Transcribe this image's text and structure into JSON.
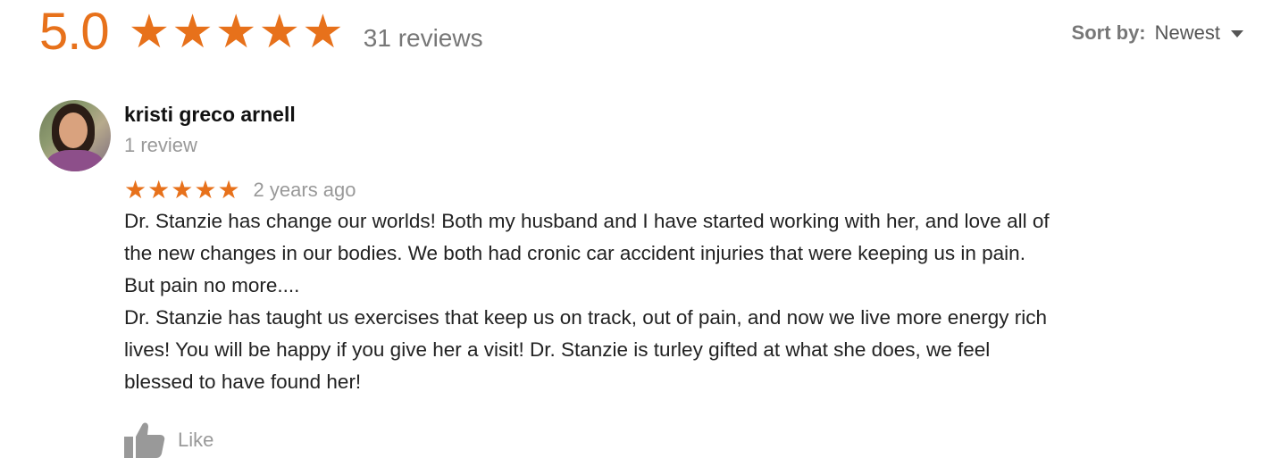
{
  "summary": {
    "score": "5.0",
    "stars": 5,
    "review_count": "31 reviews"
  },
  "sort": {
    "label": "Sort by:",
    "value": "Newest"
  },
  "review": {
    "reviewer_name": "kristi greco arnell",
    "reviewer_meta": "1 review",
    "stars": 5,
    "date": "2 years ago",
    "text_lines": [
      "Dr. Stanzie has change our worlds!  Both my husband and I have started working with her, and love all of",
      "the new changes in our bodies.  We both had cronic car accident injuries that were keeping us in pain.",
      "But pain no more....",
      "Dr. Stanzie has taught us exercises that keep us on track, out of pain, and now we live more energy rich",
      "lives!   You will be happy if you give her a visit!  Dr. Stanzie is turley gifted at what she does, we feel",
      "blessed to have found her!"
    ],
    "like_label": "Like"
  },
  "icons": {
    "star": "star-icon",
    "caret": "caret-down-icon",
    "like": "thumbs-up-icon"
  },
  "colors": {
    "accent": "#e7711b",
    "muted": "#999999",
    "text": "#222222"
  }
}
